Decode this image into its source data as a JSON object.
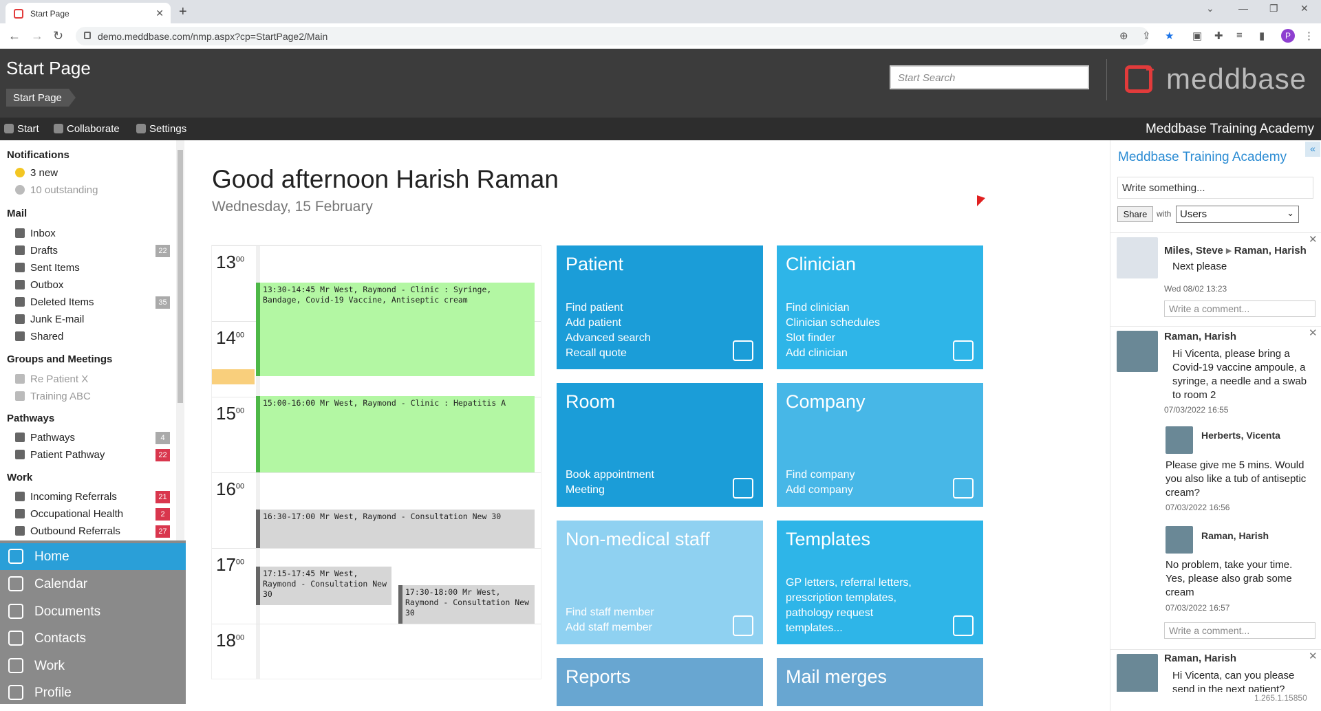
{
  "browser": {
    "tab_title": "Start Page",
    "url": "demo.meddbase.com/nmp.aspx?cp=StartPage2/Main",
    "profile_initial": "P"
  },
  "header": {
    "page_title": "Start Page",
    "breadcrumb": "Start Page",
    "search_placeholder": "Start Search",
    "logo_text": "meddbase"
  },
  "topnav": {
    "items": [
      "Start",
      "Collaborate",
      "Settings"
    ],
    "org_name": "Meddbase Training Academy"
  },
  "sidebar": {
    "notifications_header": "Notifications",
    "notifications": [
      {
        "label": "3 new",
        "icon": "star-icon"
      },
      {
        "label": "10 outstanding",
        "icon": "star-grey-icon"
      }
    ],
    "mail_header": "Mail",
    "mail": [
      {
        "label": "Inbox",
        "badge": ""
      },
      {
        "label": "Drafts",
        "badge": "22"
      },
      {
        "label": "Sent Items",
        "badge": ""
      },
      {
        "label": "Outbox",
        "badge": ""
      },
      {
        "label": "Deleted Items",
        "badge": "35"
      },
      {
        "label": "Junk E-mail",
        "badge": ""
      },
      {
        "label": "Shared",
        "badge": ""
      }
    ],
    "groups_header": "Groups and Meetings",
    "groups": [
      "Re Patient X",
      "Training ABC"
    ],
    "pathways_header": "Pathways",
    "pathways": [
      {
        "label": "Pathways",
        "badge": "4"
      },
      {
        "label": "Patient Pathway",
        "badge": "22"
      }
    ],
    "work_header": "Work",
    "work": [
      {
        "label": "Incoming Referrals",
        "badge": "21"
      },
      {
        "label": "Occupational Health",
        "badge": "2"
      },
      {
        "label": "Outbound Referrals",
        "badge": "27"
      }
    ]
  },
  "bottomnav": [
    "Home",
    "Calendar",
    "Documents",
    "Contacts",
    "Work",
    "Profile"
  ],
  "main": {
    "greeting": "Good afternoon Harish Raman",
    "date": "Wednesday, 15 February",
    "hours": [
      "13",
      "14",
      "15",
      "16",
      "17",
      "18"
    ],
    "hour_suffix": "00",
    "appointments": [
      "13:30-14:45 Mr West, Raymond - Clinic : Syringe, Bandage, Covid-19 Vaccine, Antiseptic cream",
      "15:00-16:00 Mr West, Raymond - Clinic : Hepatitis A",
      "16:30-17:00 Mr West, Raymond - Consultation New 30",
      "17:15-17:45 Mr West, Raymond - Consultation New 30",
      "17:30-18:00 Mr West, Raymond - Consultation New 30"
    ],
    "tiles": [
      {
        "title": "Patient",
        "links": [
          "Find patient",
          "Add patient",
          "Advanced search",
          "Recall quote"
        ]
      },
      {
        "title": "Clinician",
        "links": [
          "Find clinician",
          "Clinician schedules",
          "Slot finder",
          "Add clinician"
        ]
      },
      {
        "title": "Room",
        "links": [
          "Book appointment",
          "Meeting"
        ]
      },
      {
        "title": "Company",
        "links": [
          "Find company",
          "Add company"
        ]
      },
      {
        "title": "Non-medical staff",
        "links": [
          "Find staff member",
          "Add staff member"
        ]
      },
      {
        "title": "Templates",
        "links": [
          "GP letters, referral letters,",
          "prescription templates,",
          "pathology request",
          "templates..."
        ]
      },
      {
        "title": "Reports",
        "links": []
      },
      {
        "title": "Mail merges",
        "links": []
      }
    ]
  },
  "rightpanel": {
    "title": "Meddbase Training Academy",
    "write_placeholder": "Write something...",
    "share_label": "Share",
    "with_label": "with",
    "audience": "Users",
    "comment_placeholder": "Write a comment...",
    "posts": [
      {
        "author": "Miles, Steve",
        "recipient": "Raman, Harish",
        "text": "Next please",
        "time": "Wed 08/02 13:23"
      },
      {
        "author": "Raman, Harish",
        "text": "Hi Vicenta, please bring a Covid-19 vaccine ampoule, a syringe, a needle and a swab to room 2",
        "time": "07/03/2022 16:55",
        "replies": [
          {
            "author": "Herberts, Vicenta",
            "text": "Please give me 5 mins. Would you also like a tub of antiseptic cream?",
            "time": "07/03/2022 16:56"
          },
          {
            "author": "Raman, Harish",
            "text": "No problem, take your time. Yes, please also grab some cream",
            "time": "07/03/2022 16:57"
          }
        ]
      },
      {
        "author": "Raman, Harish",
        "text": "Hi Vicenta, can you please send in the next patient?"
      }
    ],
    "version": "1.265.1.15850"
  }
}
